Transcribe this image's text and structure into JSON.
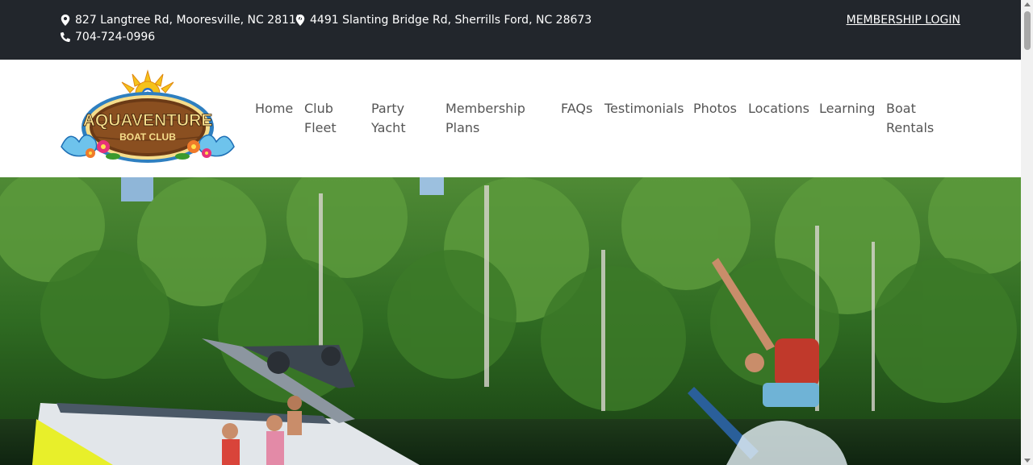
{
  "topbar": {
    "address_1": "827 Langtree Rd, Mooresville, NC 28117",
    "address_2": "4491 Slanting Bridge Rd, Sherrills Ford, NC 28673",
    "phone": "704-724-0996",
    "login_label": "MEMBERSHIP LOGIN"
  },
  "logo": {
    "line1": "AQUAVENTURE",
    "line2": "BOAT CLUB"
  },
  "nav": {
    "items": [
      {
        "line1": "Home",
        "line2": ""
      },
      {
        "line1": "Club",
        "line2": "Fleet"
      },
      {
        "line1": "Party",
        "line2": "Yacht"
      },
      {
        "line1": "Membership",
        "line2": "Plans"
      },
      {
        "line1": "FAQs",
        "line2": ""
      },
      {
        "line1": "Testimonials",
        "line2": ""
      },
      {
        "line1": "Photos",
        "line2": ""
      },
      {
        "line1": "Locations",
        "line2": ""
      },
      {
        "line1": "Learning",
        "line2": ""
      },
      {
        "line1": "Boat",
        "line2": "Rentals"
      }
    ]
  },
  "colors": {
    "topbar_bg": "#22262c",
    "nav_text": "#555555"
  }
}
